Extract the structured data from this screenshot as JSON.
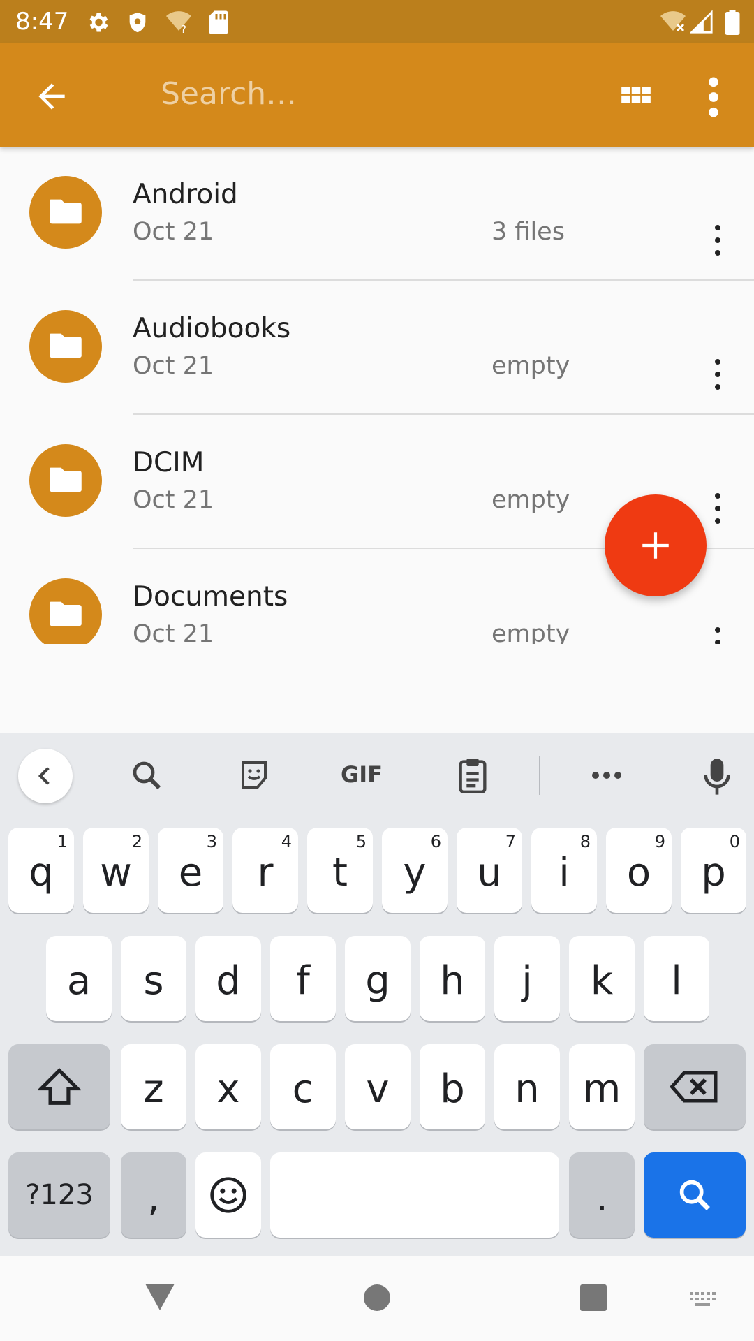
{
  "status_bar": {
    "time": "8:47",
    "icons": [
      "settings-icon",
      "shield-icon",
      "wifi-question-icon",
      "sd-card-icon",
      "wifi-off-icon",
      "signal-icon",
      "battery-icon"
    ]
  },
  "app_bar": {
    "back_icon": "arrow-back-icon",
    "search_placeholder": "Search…",
    "grid_icon": "grid-view-icon",
    "overflow_icon": "more-vert-icon",
    "color": "#d4891b"
  },
  "files": [
    {
      "name": "Android",
      "date": "Oct 21",
      "info": "3 files"
    },
    {
      "name": "Audiobooks",
      "date": "Oct 21",
      "info": "empty"
    },
    {
      "name": "DCIM",
      "date": "Oct 21",
      "info": "empty"
    },
    {
      "name": "Documents",
      "date": "Oct 21",
      "info": "empty"
    }
  ],
  "fab": {
    "icon": "plus-icon",
    "color": "#ef3a12"
  },
  "keyboard": {
    "toolbar": [
      "back-chevron-icon",
      "search-icon",
      "sticker-icon",
      "GIF",
      "clipboard-icon",
      "more-horiz-icon",
      "mic-icon"
    ],
    "row1": [
      {
        "k": "q",
        "h": "1"
      },
      {
        "k": "w",
        "h": "2"
      },
      {
        "k": "e",
        "h": "3"
      },
      {
        "k": "r",
        "h": "4"
      },
      {
        "k": "t",
        "h": "5"
      },
      {
        "k": "y",
        "h": "6"
      },
      {
        "k": "u",
        "h": "7"
      },
      {
        "k": "i",
        "h": "8"
      },
      {
        "k": "o",
        "h": "9"
      },
      {
        "k": "p",
        "h": "0"
      }
    ],
    "row2": [
      "a",
      "s",
      "d",
      "f",
      "g",
      "h",
      "j",
      "k",
      "l"
    ],
    "row3": [
      "z",
      "x",
      "c",
      "v",
      "b",
      "n",
      "m"
    ],
    "symbols_label": "?123",
    "comma_label": ",",
    "period_label": ".",
    "search_key_color": "#1a73e8"
  },
  "nav_bar": {
    "icons": [
      "back-triangle-icon",
      "home-circle-icon",
      "recents-square-icon",
      "keyboard-switch-icon"
    ]
  }
}
